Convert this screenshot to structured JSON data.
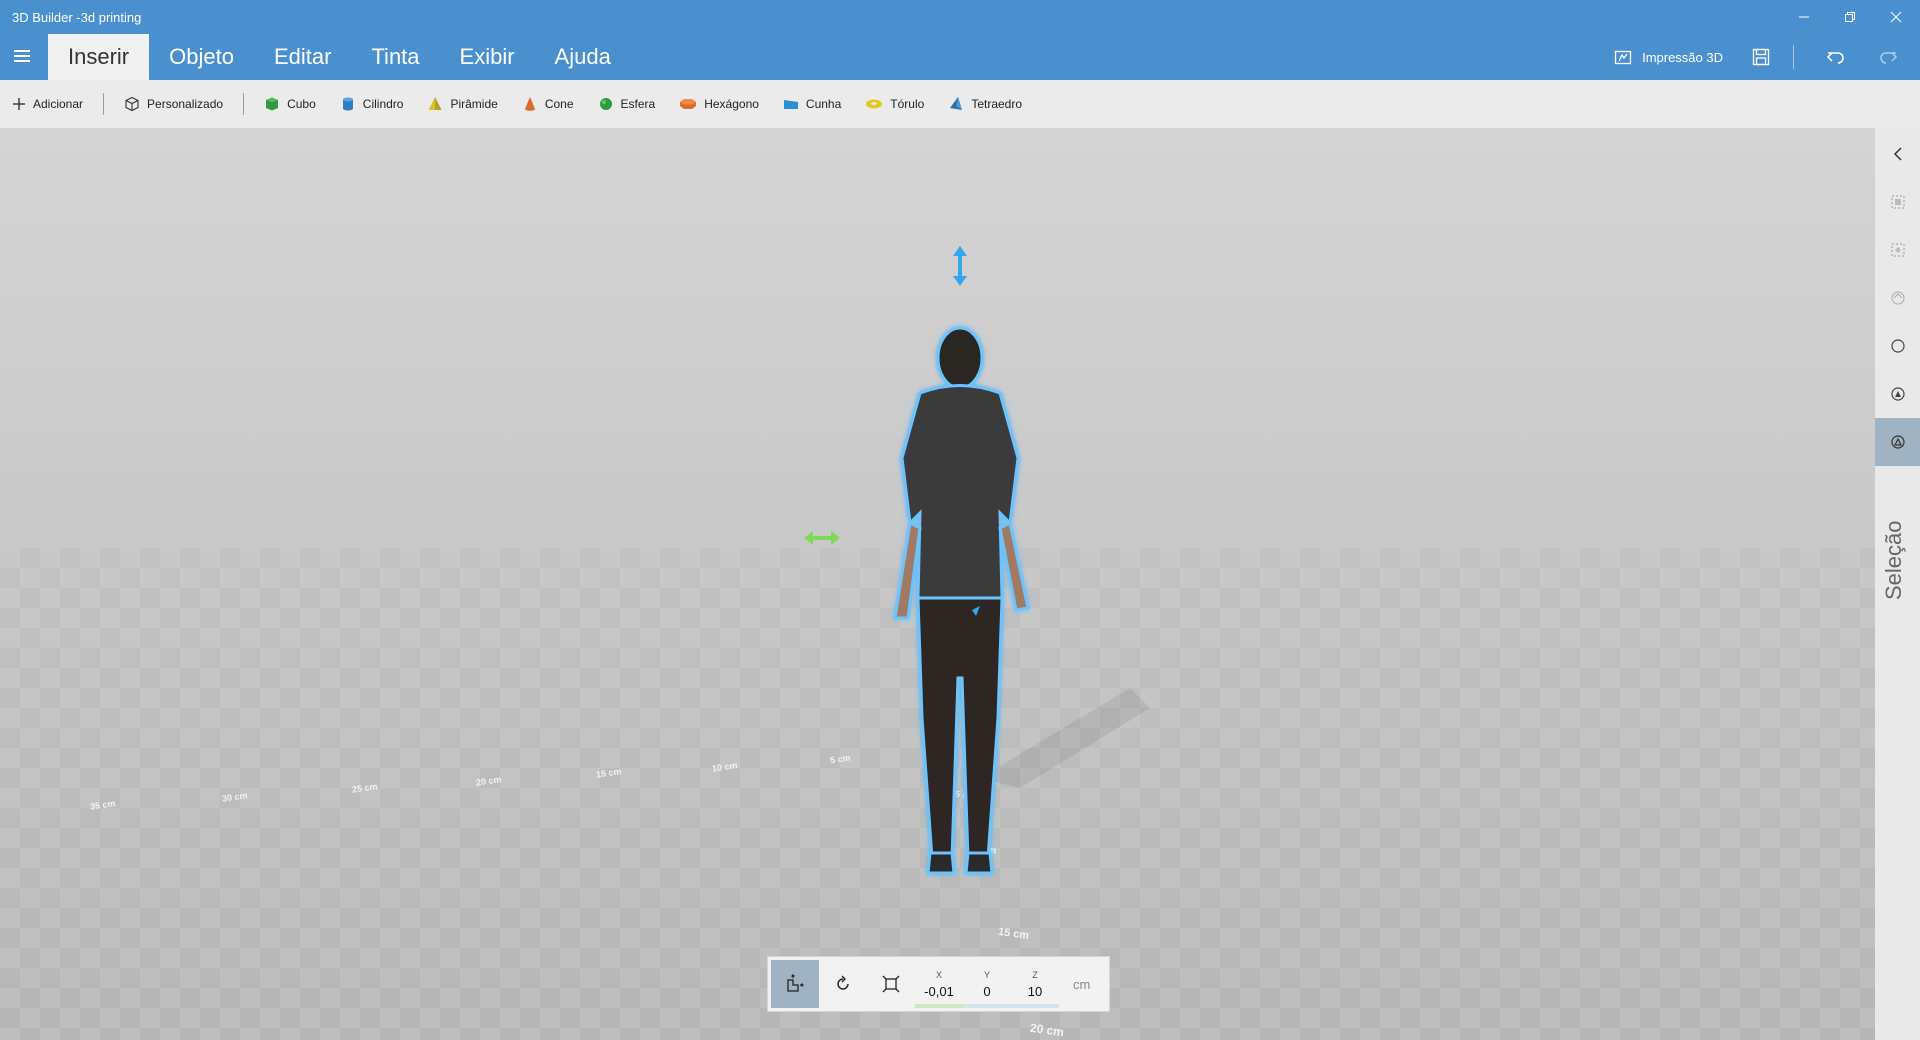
{
  "window": {
    "title": "3D Builder -3d printing"
  },
  "tabs": [
    {
      "label": "Inserir",
      "active": true
    },
    {
      "label": "Objeto"
    },
    {
      "label": "Editar"
    },
    {
      "label": "Tinta"
    },
    {
      "label": "Exibir"
    },
    {
      "label": "Ajuda"
    }
  ],
  "actions": {
    "print_label": "Impressão 3D"
  },
  "toolbar": {
    "add_label": "Adicionar",
    "custom_label": "Personalizado",
    "shapes": [
      {
        "label": "Cubo",
        "color": "#2e9b3c"
      },
      {
        "label": "Cilindro",
        "color": "#2f7fc0"
      },
      {
        "label": "Pirâmide",
        "color": "#d9c22e"
      },
      {
        "label": "Cone",
        "color": "#d86b2a"
      },
      {
        "label": "Esfera",
        "color": "#2e9b3c"
      },
      {
        "label": "Hexágono",
        "color": "#e06a2a"
      },
      {
        "label": "Cunha",
        "color": "#2a8fd4"
      },
      {
        "label": "Tórulo",
        "color": "#e2c81e"
      },
      {
        "label": "Tetraedro",
        "color": "#2a6fa8"
      }
    ]
  },
  "ruler": {
    "labels": [
      "35 cm",
      "30 cm",
      "25 cm",
      "20 cm",
      "15 cm",
      "10 cm",
      "5 cm",
      "5 cm",
      "10 cm",
      "15 cm",
      "20 cm"
    ]
  },
  "transform": {
    "x": {
      "label": "X",
      "value": "-0,01"
    },
    "y": {
      "label": "Y",
      "value": "0"
    },
    "z": {
      "label": "Z",
      "value": "10"
    },
    "unit": "cm"
  },
  "rightpanel": {
    "selection_label": "Seleção"
  },
  "colors": {
    "accent": "#4a90cf",
    "selection_glow": "#5ab6f0",
    "move_vertical": "#33a7ee",
    "move_horizontal": "#7ed957"
  }
}
